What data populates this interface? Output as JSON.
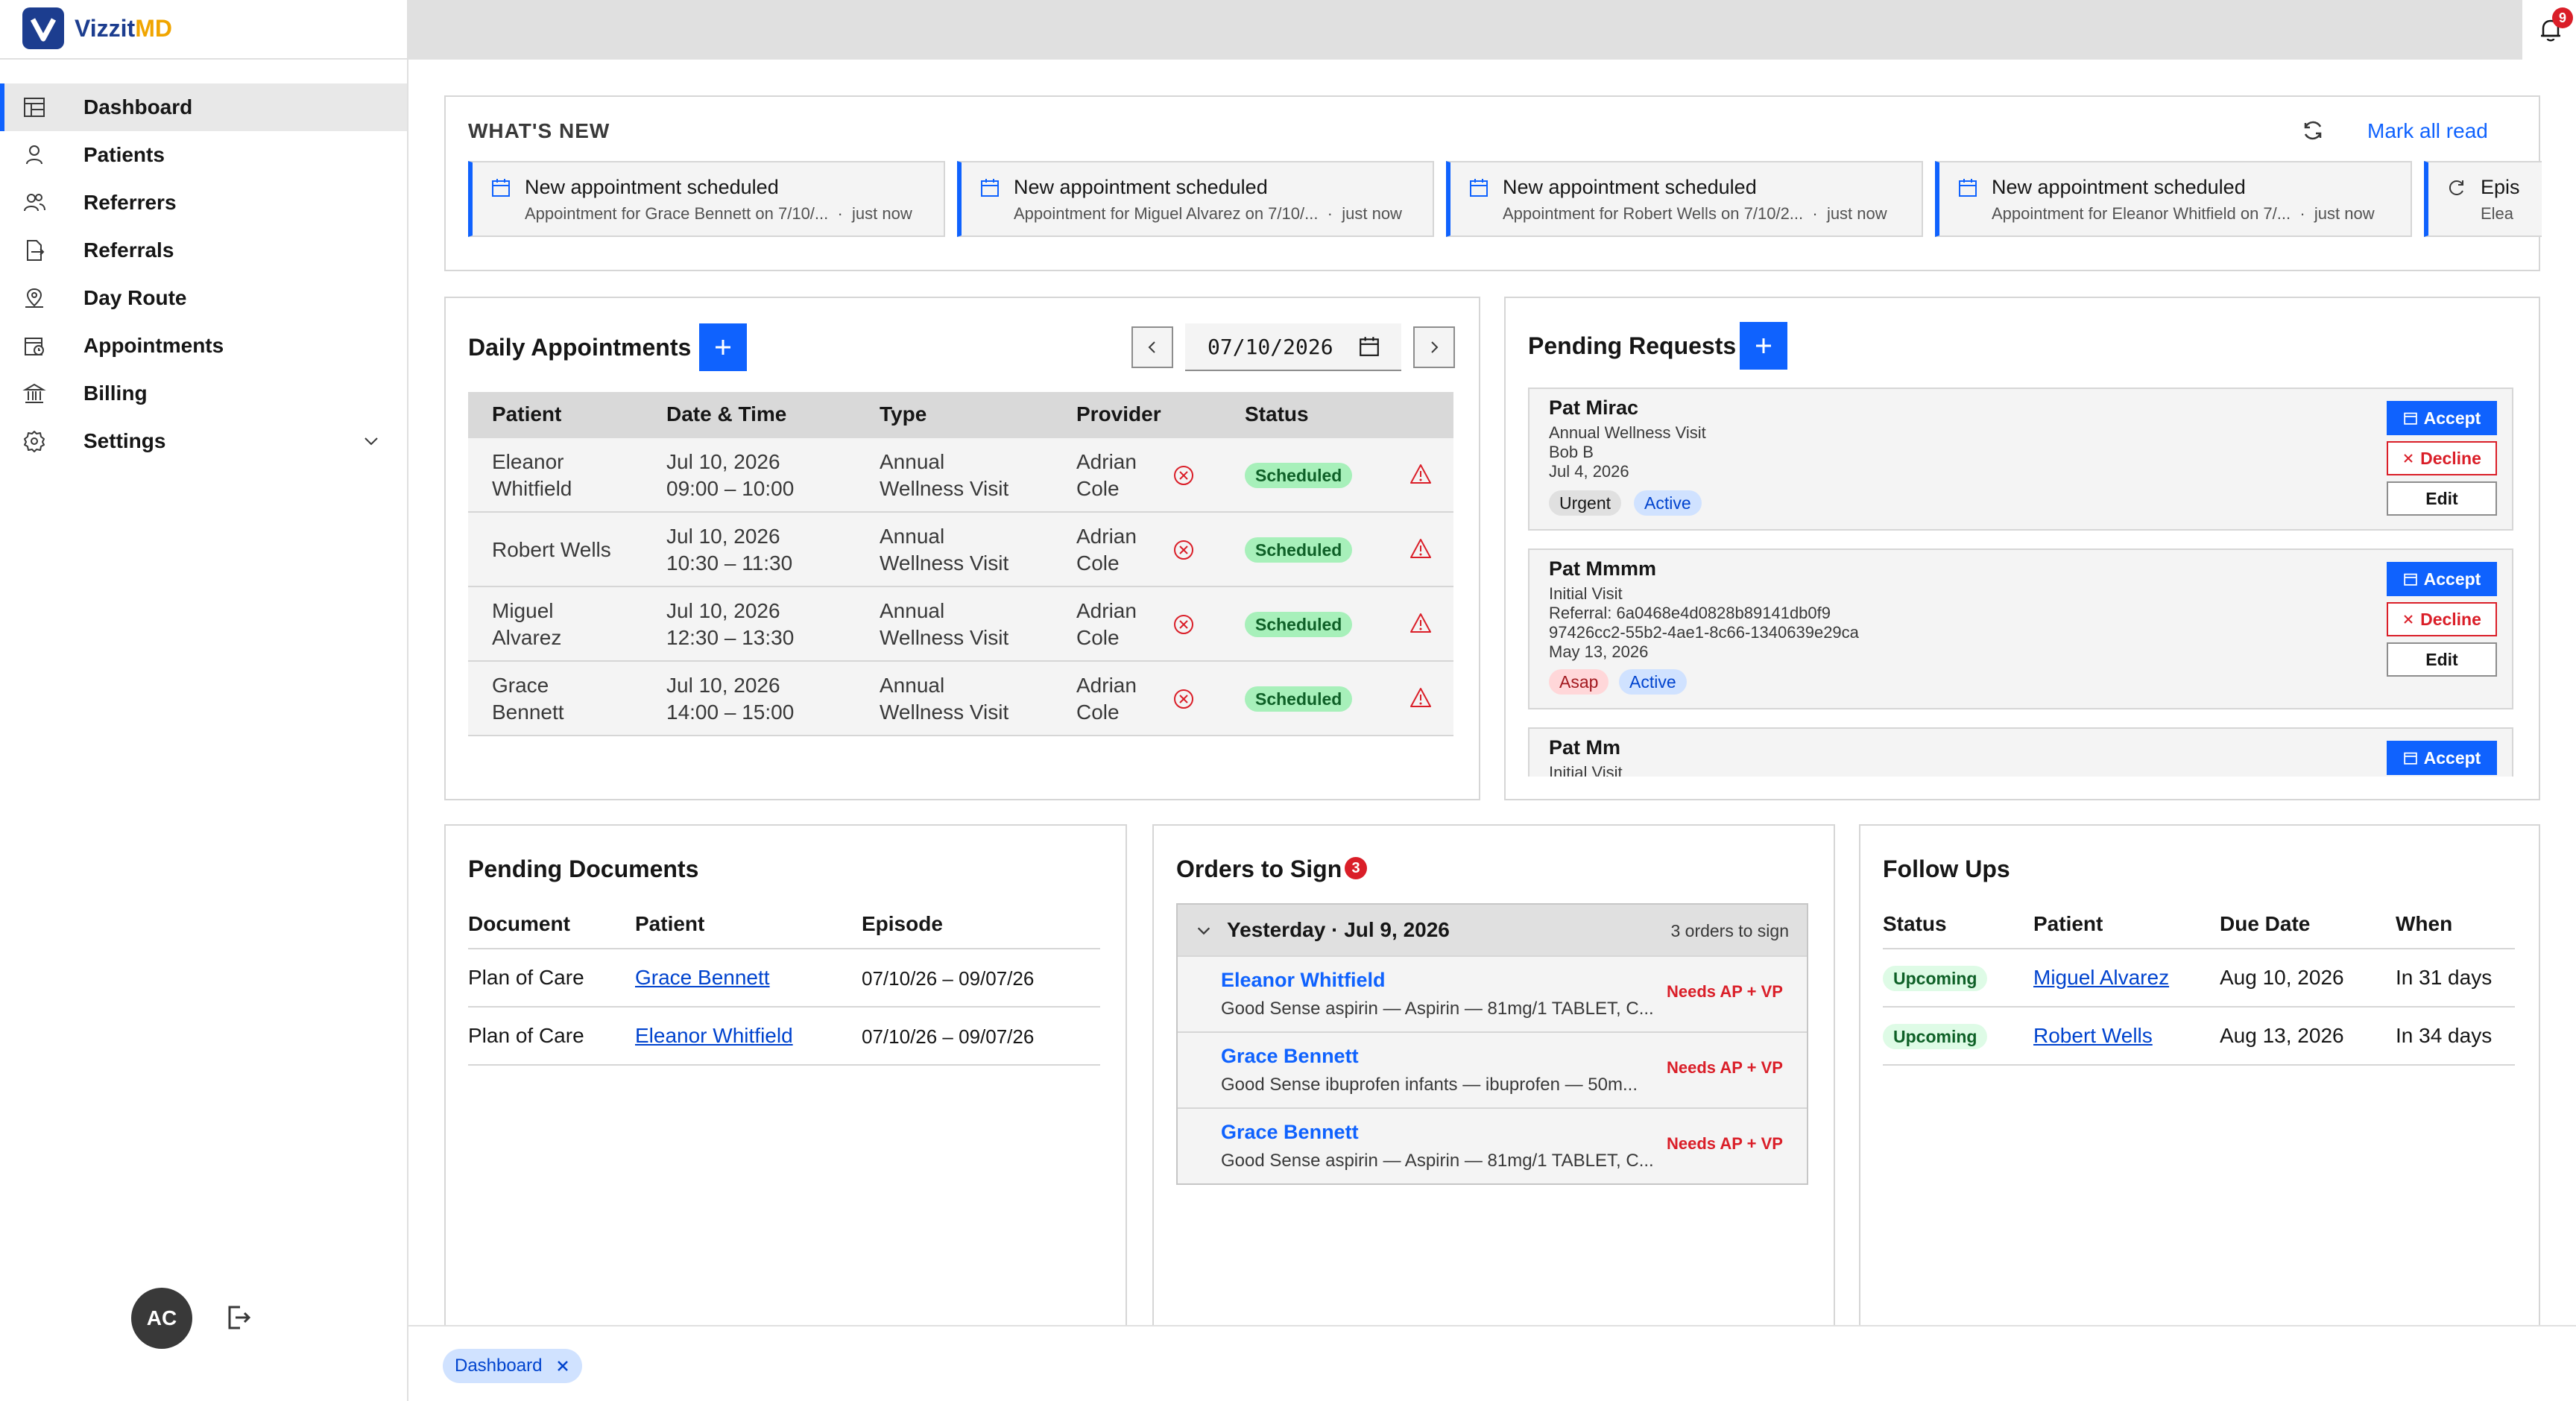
{
  "app": {
    "brand_main": "Vizzit",
    "brand_accent": "MD",
    "brand_color": "#1c3d8f",
    "accent_color": "#0f62fe"
  },
  "sidebar": {
    "items": [
      {
        "label": "Dashboard",
        "icon": "dashboard-icon"
      },
      {
        "label": "Patients",
        "icon": "user-icon"
      },
      {
        "label": "Referrers",
        "icon": "users-icon"
      },
      {
        "label": "Referrals",
        "icon": "document-export-icon"
      },
      {
        "label": "Day Route",
        "icon": "map-pin-icon"
      },
      {
        "label": "Appointments",
        "icon": "calendar-clock-icon"
      },
      {
        "label": "Billing",
        "icon": "bank-icon"
      },
      {
        "label": "Settings",
        "icon": "gear-icon"
      }
    ],
    "user_initials": "AC"
  },
  "topbar": {
    "notification_count": "9"
  },
  "whats_new": {
    "label": "WHAT'S NEW",
    "mark_all_read": "Mark all read",
    "items": [
      {
        "title": "New appointment scheduled",
        "sub": "Appointment for Grace Bennett on 7/10/...",
        "time": "just now"
      },
      {
        "title": "New appointment scheduled",
        "sub": "Appointment for Miguel Alvarez on 7/10/...",
        "time": "just now"
      },
      {
        "title": "New appointment scheduled",
        "sub": "Appointment for Robert Wells on 7/10/2...",
        "time": "just now"
      },
      {
        "title": "New appointment scheduled",
        "sub": "Appointment for Eleanor Whitfield on 7/...",
        "time": "just now"
      },
      {
        "title": "Epis",
        "sub": "Elea",
        "time": ""
      }
    ]
  },
  "daily_appointments": {
    "title": "Daily Appointments",
    "date": "07/10/2026",
    "columns": [
      "Patient",
      "Date & Time",
      "Type",
      "Provider",
      "Status"
    ],
    "rows": [
      {
        "patient": [
          "Eleanor",
          "Whitfield"
        ],
        "date": "Jul 10, 2026",
        "time": "09:00 – 10:00",
        "type": [
          "Annual",
          "Wellness Visit"
        ],
        "provider": [
          "Adrian",
          "Cole"
        ],
        "status": "Scheduled"
      },
      {
        "patient": [
          "Robert Wells",
          ""
        ],
        "date": "Jul 10, 2026",
        "time": "10:30 – 11:30",
        "type": [
          "Annual",
          "Wellness Visit"
        ],
        "provider": [
          "Adrian",
          "Cole"
        ],
        "status": "Scheduled"
      },
      {
        "patient": [
          "Miguel",
          "Alvarez"
        ],
        "date": "Jul 10, 2026",
        "time": "12:30 – 13:30",
        "type": [
          "Annual",
          "Wellness Visit"
        ],
        "provider": [
          "Adrian",
          "Cole"
        ],
        "status": "Scheduled"
      },
      {
        "patient": [
          "Grace",
          "Bennett"
        ],
        "date": "Jul 10, 2026",
        "time": "14:00 – 15:00",
        "type": [
          "Annual",
          "Wellness Visit"
        ],
        "provider": [
          "Adrian",
          "Cole"
        ],
        "status": "Scheduled"
      }
    ]
  },
  "pending_requests": {
    "title": "Pending Requests",
    "accept_label": "Accept",
    "decline_label": "Decline",
    "edit_label": "Edit",
    "items": [
      {
        "name": "Pat Mirac",
        "lines": [
          "Annual Wellness Visit",
          "Bob B",
          "Jul 4, 2026"
        ],
        "tags": [
          "Urgent",
          "Active"
        ]
      },
      {
        "name": "Pat Mmmm",
        "lines": [
          "Initial Visit",
          "Referral: 6a0468e4d0828b89141db0f9",
          "97426cc2-55b2-4ae1-8c66-1340639e29ca",
          "May 13, 2026"
        ],
        "tags": [
          "Asap",
          "Active"
        ]
      },
      {
        "name": "Pat Mm",
        "lines": [
          "Initial Visit"
        ],
        "tags": []
      }
    ]
  },
  "pending_documents": {
    "title": "Pending Documents",
    "columns": [
      "Document",
      "Patient",
      "Episode"
    ],
    "rows": [
      {
        "document": "Plan of Care",
        "patient": "Grace Bennett",
        "episode": "07/10/26 – 09/07/26"
      },
      {
        "document": "Plan of Care",
        "patient": "Eleanor Whitfield",
        "episode": "07/10/26 – 09/07/26"
      }
    ]
  },
  "orders_to_sign": {
    "title": "Orders to Sign",
    "badge": "3",
    "group_label": "Yesterday · Jul 9, 2026",
    "group_count": "3 orders to sign",
    "rows": [
      {
        "patient": "Eleanor Whitfield",
        "med": "Good Sense aspirin — Aspirin — 81mg/1 TABLET, C...",
        "flag": "Needs AP + VP"
      },
      {
        "patient": "Grace Bennett",
        "med": "Good Sense ibuprofen infants — ibuprofen — 50m...",
        "flag": "Needs AP + VP"
      },
      {
        "patient": "Grace Bennett",
        "med": "Good Sense aspirin — Aspirin — 81mg/1 TABLET, C...",
        "flag": "Needs AP + VP"
      }
    ]
  },
  "follow_ups": {
    "title": "Follow Ups",
    "columns": [
      "Status",
      "Patient",
      "Due Date",
      "When"
    ],
    "rows": [
      {
        "status": "Upcoming",
        "patient": "Miguel Alvarez",
        "due": "Aug 10, 2026",
        "when": "In 31 days"
      },
      {
        "status": "Upcoming",
        "patient": "Robert Wells",
        "due": "Aug 13, 2026",
        "when": "In 34 days"
      }
    ]
  },
  "bottom_tabs": {
    "items": [
      "Dashboard"
    ]
  }
}
